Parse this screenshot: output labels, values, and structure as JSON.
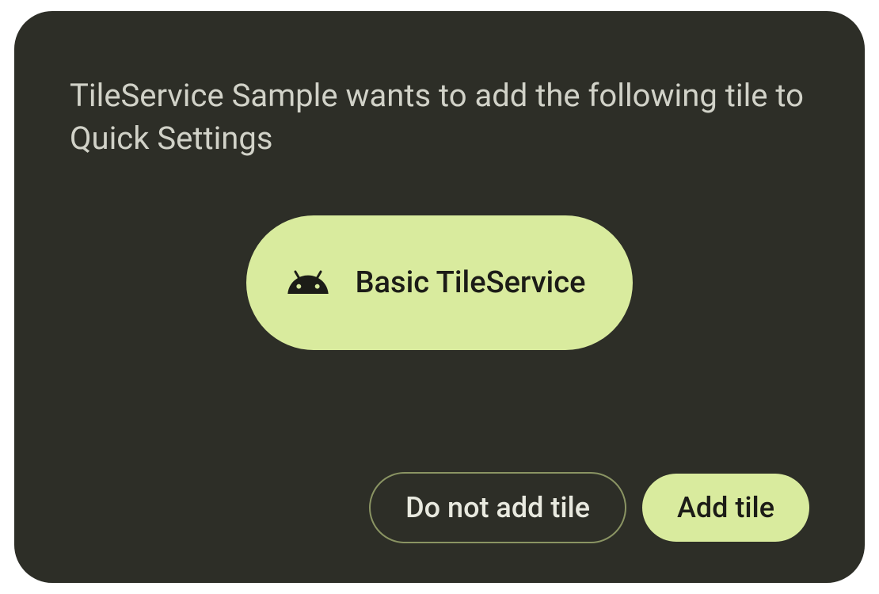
{
  "dialog": {
    "message": "TileService Sample wants to add the following tile to Quick Settings",
    "tile": {
      "label": "Basic TileService",
      "icon": "android-head-icon"
    },
    "buttons": {
      "deny": "Do not add tile",
      "accept": "Add tile"
    }
  },
  "colors": {
    "dialog_bg": "#2d2e27",
    "accent": "#d9eb9e",
    "outline": "#8a9463",
    "text_light": "#d1d2c8",
    "text_dark": "#1c1c17"
  }
}
